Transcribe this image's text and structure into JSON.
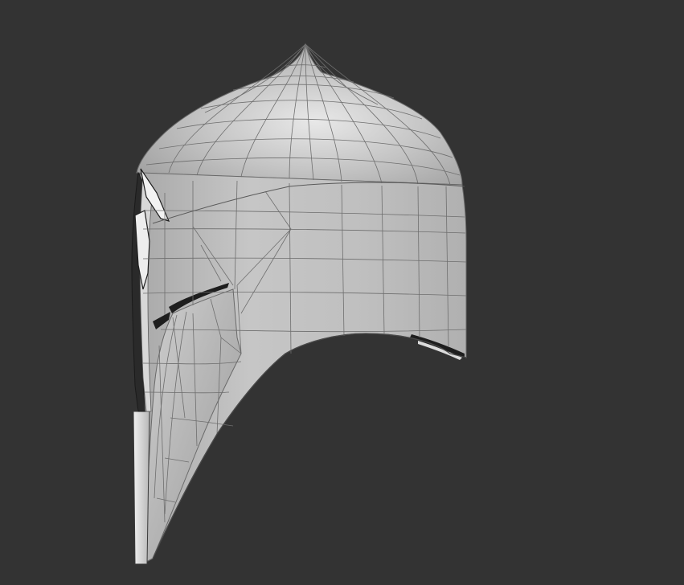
{
  "viewport": {
    "background": "#333333",
    "model_fill": "#b9b9b9",
    "highlight": "#e6e6e6",
    "wire": "#5a5a5a",
    "edge_dark": "#1e1e1e"
  },
  "model": {
    "name": "helmet-mesh",
    "shading": "wireframe-on-shaded"
  }
}
